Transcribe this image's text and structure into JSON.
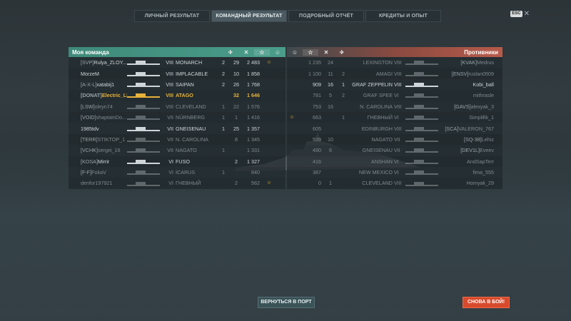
{
  "tabs": [
    "ЛИЧНЫЙ РЕЗУЛЬТАТ",
    "КОМАНДНЫЙ РЕЗУЛЬТАТ",
    "ПОДРОБНЫЙ ОТЧЁТ",
    "КРЕДИТЫ И ОПЫТ"
  ],
  "active_tab": "КОМАНДНЫЙ РЕЗУЛЬТАТ",
  "esc_label": "ESC",
  "my_team": {
    "title": "Моя команда",
    "players": [
      {
        "clan": "[SVP]",
        "name": "Rulya_ZLOY...",
        "tier": "VIII",
        "ship": "MONARCH",
        "planes": "2",
        "kills": "29",
        "base": "2 483",
        "smile": "☺",
        "style": ""
      },
      {
        "clan": "",
        "name": "MorzeM",
        "tier": "VIII",
        "ship": "IMPLACABLE",
        "planes": "2",
        "kills": "10",
        "base": "1 858",
        "smile": "",
        "style": ""
      },
      {
        "clan": "[A-X-L]",
        "name": "xatabij1",
        "tier": "VIII",
        "ship": "SAIPAN",
        "planes": "2",
        "kills": "26",
        "base": "1 768",
        "smile": "",
        "style": ""
      },
      {
        "clan": "[DONAT]",
        "name": "Electric_Li...",
        "tier": "VIII",
        "ship": "ATAGO",
        "planes": "",
        "kills": "32",
        "base": "1 646",
        "smile": "",
        "style": "gold"
      },
      {
        "clan": "[LSW]",
        "name": "oleyn74",
        "tier": "VIII",
        "ship": "CLEVELAND",
        "planes": "1",
        "kills": "22",
        "base": "1 576",
        "smile": "",
        "style": "dim"
      },
      {
        "clan": "[VOID]",
        "name": "shaptainDo...",
        "tier": "VII",
        "ship": "NÜRNBERG",
        "planes": "1",
        "kills": "1",
        "base": "1 416",
        "smile": "",
        "style": "dim"
      },
      {
        "clan": "",
        "name": "1985tdv",
        "tier": "VII",
        "ship": "GNEISENAU",
        "planes": "1",
        "kills": "25",
        "base": "1 357",
        "smile": "",
        "style": ""
      },
      {
        "clan": "[TERR]",
        "name": "STIKTOP_1",
        "tier": "VII",
        "ship": "N. CAROLINA",
        "planes": "",
        "kills": "8",
        "base": "1 345",
        "smile": "",
        "style": "dim"
      },
      {
        "clan": "[VCHK]",
        "name": "sergei_16",
        "tier": "VII",
        "ship": "NAGATO",
        "planes": "1",
        "kills": "",
        "base": "1 331",
        "smile": "",
        "style": "dim"
      },
      {
        "clan": "[KOSA]",
        "name": "Mirrir",
        "tier": "VI",
        "ship": "FUSO",
        "planes": "",
        "kills": "2",
        "base": "1 327",
        "smile": "",
        "style": ""
      },
      {
        "clan": "[F-F]",
        "name": "FokaV",
        "tier": "VI",
        "ship": "ICARUS",
        "planes": "1",
        "kills": "",
        "base": "840",
        "smile": "",
        "style": "dim"
      },
      {
        "clan": "",
        "name": "denfor197921",
        "tier": "VI",
        "ship": "ГНЕВНЫЙ",
        "planes": "",
        "kills": "2",
        "base": "562",
        "smile": "☺",
        "style": "dim"
      }
    ]
  },
  "enemy_team": {
    "title": "Противники",
    "players": [
      {
        "smile": "",
        "base": "1 235",
        "kills": "24",
        "planes": "",
        "ship": "LEXINGTON",
        "tier": "VIII",
        "clan": "[KVAK]",
        "name": "Medrus",
        "style": "dim"
      },
      {
        "smile": "",
        "base": "1 100",
        "kills": "11",
        "planes": "2",
        "ship": "AMAGI",
        "tier": "VIII",
        "clan": "[ENSV]",
        "name": "ruslan0509",
        "style": "dim"
      },
      {
        "smile": "",
        "base": "909",
        "kills": "16",
        "planes": "1",
        "ship": "GRAF ZEPPELIN",
        "tier": "VIII",
        "clan": "",
        "name": "Kobi_ball",
        "style": ""
      },
      {
        "smile": "",
        "base": "781",
        "kills": "5",
        "planes": "2",
        "ship": "GRAF SPEE",
        "tier": "VI",
        "clan": "",
        "name": "mithrasle",
        "style": "dim"
      },
      {
        "smile": "",
        "base": "753",
        "kills": "16",
        "planes": "",
        "ship": "N. CAROLINA",
        "tier": "VIII",
        "clan": "[GAVS]",
        "name": "alexyak_3",
        "style": "dim"
      },
      {
        "smile": "☺",
        "base": "663",
        "kills": "",
        "planes": "1",
        "ship": "ГНЕВНЫЙ",
        "tier": "VI",
        "clan": "",
        "name": "Simplifik_1",
        "style": "dim"
      },
      {
        "smile": "",
        "base": "605",
        "kills": "",
        "planes": "",
        "ship": "EDINBURGH",
        "tier": "VIII",
        "clan": "[SCA]",
        "name": "VALERON_767",
        "style": "dim"
      },
      {
        "smile": "",
        "base": "539",
        "kills": "10",
        "planes": "",
        "ship": "NAGATO",
        "tier": "VII",
        "clan": "[SQ-38]",
        "name": "Lehiz",
        "style": "dim"
      },
      {
        "smile": "",
        "base": "490",
        "kills": "6",
        "planes": "",
        "ship": "GNEISENAU",
        "tier": "VII",
        "clan": "[DEV1L]",
        "name": "Eveev",
        "style": "dim"
      },
      {
        "smile": "",
        "base": "416",
        "kills": "",
        "planes": "",
        "ship": "ANSHAN",
        "tier": "VI",
        "clan": "",
        "name": "AndSapTerr",
        "style": "dim"
      },
      {
        "smile": "",
        "base": "387",
        "kills": "",
        "planes": "",
        "ship": "NEW MEXICO",
        "tier": "VI",
        "clan": "",
        "name": "fima_555",
        "style": "dim"
      },
      {
        "smile": "",
        "base": "0",
        "kills": "1",
        "planes": "",
        "ship": "CLEVELAND",
        "tier": "VIII",
        "clan": "",
        "name": "Homyak_29",
        "style": "dim"
      }
    ]
  },
  "buttons": {
    "port": "ВЕРНУТЬСЯ В ПОРТ",
    "battle": "СНОВА В БОЙ!"
  },
  "colors": {
    "my_team": "#4a9d8a",
    "enemy_team": "#b75b4b",
    "highlight": "#e7b23a",
    "battle_button": "#d84a2c"
  }
}
